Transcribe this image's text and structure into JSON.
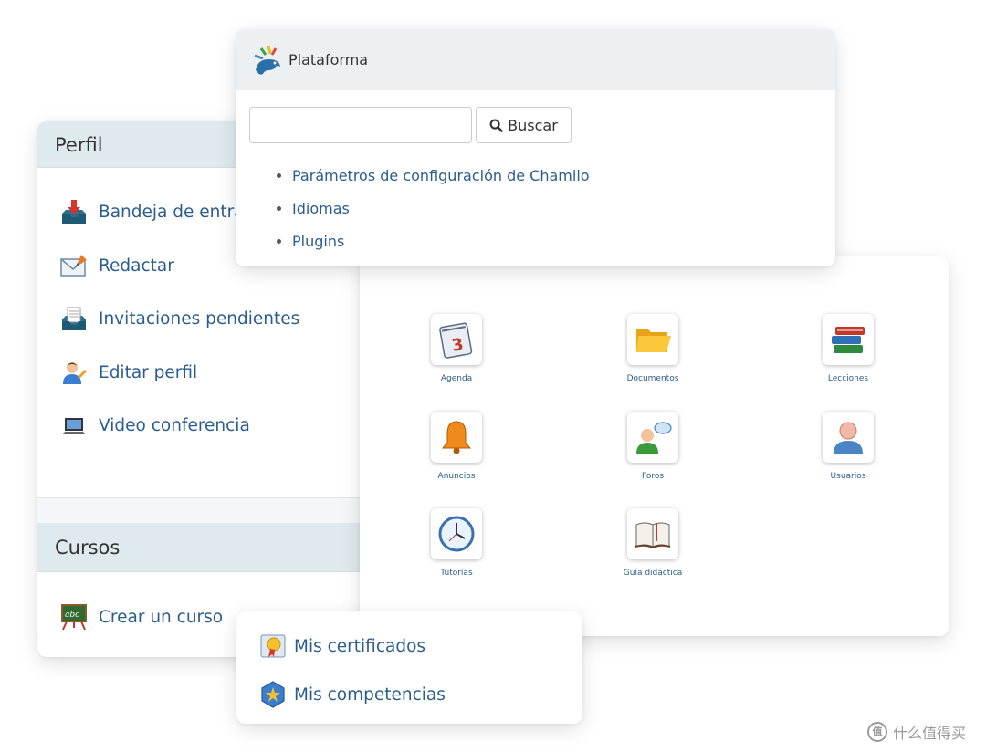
{
  "perfil": {
    "title": "Perfil",
    "items": [
      {
        "label": "Bandeja de entrada",
        "icon": "inbox-icon"
      },
      {
        "label": "Redactar",
        "icon": "compose-mail-icon"
      },
      {
        "label": "Invitaciones pendientes",
        "icon": "pending-invitations-icon"
      },
      {
        "label": "Editar perfil",
        "icon": "edit-profile-icon"
      },
      {
        "label": "Video conferencia",
        "icon": "video-conference-icon"
      }
    ]
  },
  "cursos": {
    "title": "Cursos",
    "items": [
      {
        "label": "Crear un curso",
        "icon": "chalkboard-icon"
      }
    ]
  },
  "plataforma": {
    "title": "Plataforma",
    "search_value": "",
    "search_button": "Buscar",
    "links": [
      "Parámetros de configuración de Chamilo",
      "Idiomas",
      "Plugins"
    ]
  },
  "tools": [
    {
      "label": "Agenda",
      "icon": "calendar-icon"
    },
    {
      "label": "Documentos",
      "icon": "folder-icon"
    },
    {
      "label": "Lecciones",
      "icon": "books-icon"
    },
    {
      "label": "Anuncios",
      "icon": "bell-icon"
    },
    {
      "label": "Foros",
      "icon": "forum-icon"
    },
    {
      "label": "Usuarios",
      "icon": "user-icon"
    },
    {
      "label": "Tutorías",
      "icon": "clock-icon"
    },
    {
      "label": "Guía didáctica",
      "icon": "open-book-icon"
    }
  ],
  "certs": {
    "items": [
      {
        "label": "Mis certificados",
        "icon": "certificate-icon"
      },
      {
        "label": "Mis competencias",
        "icon": "badge-icon"
      }
    ]
  },
  "watermark": {
    "text": "什么值得买",
    "mark": "值"
  }
}
